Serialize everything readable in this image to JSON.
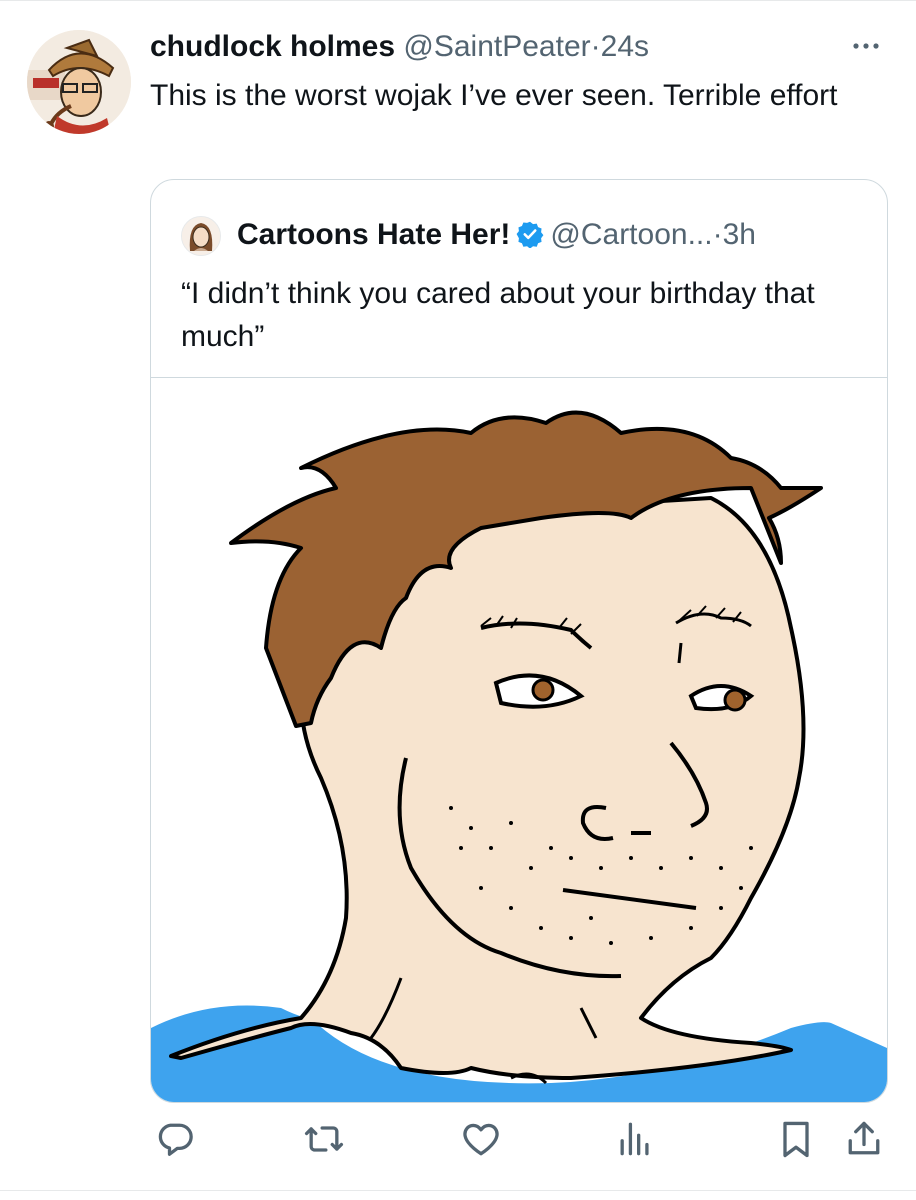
{
  "tweet": {
    "author_name": "chudlock holmes",
    "handle": "@SaintPeater",
    "separator": "·",
    "time": "24s",
    "text": "This is the worst wojak I’ve ever seen. Terrible effort"
  },
  "quoted_tweet": {
    "author_name": "Cartoons Hate Her!",
    "handle": "@Cartoon...",
    "separator": "·",
    "time": "3h",
    "text": "“I didn’t think you cared about your birthday that much”",
    "verified": true
  },
  "icons": {
    "more": "more-horizontal-icon",
    "verified": "verified-badge-icon",
    "reply": "reply-icon",
    "retweet": "retweet-icon",
    "like": "like-icon",
    "views": "views-icon",
    "bookmark": "bookmark-icon",
    "share": "share-icon"
  },
  "colors": {
    "text_primary": "#0f1419",
    "text_secondary": "#536471",
    "border": "#cfd9de",
    "verified_blue": "#1d9bf0",
    "skin": "#f7e4cf",
    "hair": "#9b6233",
    "shirt": "#3ea3ee"
  }
}
